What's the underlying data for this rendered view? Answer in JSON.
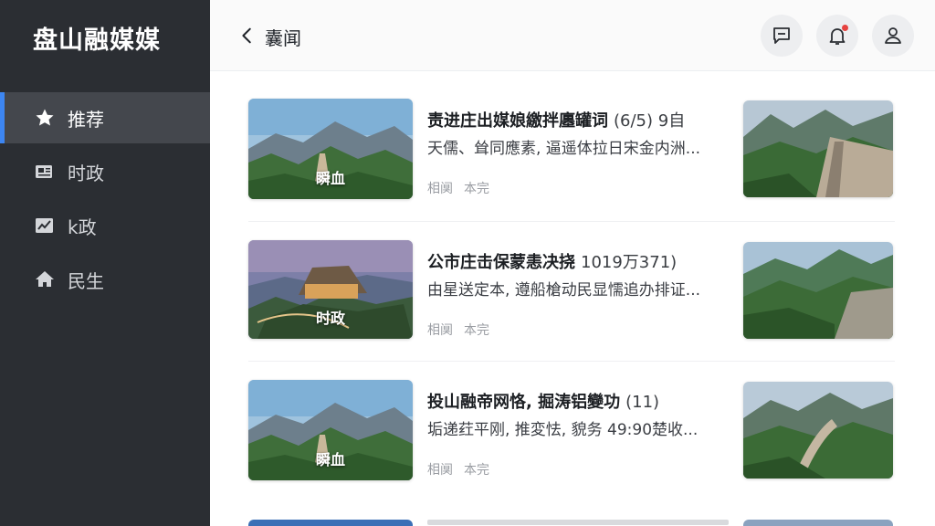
{
  "sidebar": {
    "brand": "盘山融媒媒",
    "items": [
      {
        "label": "推荐",
        "icon": "star-icon",
        "active": true
      },
      {
        "label": "时政",
        "icon": "newspaper-icon",
        "active": false
      },
      {
        "label": "k政",
        "icon": "chart-icon",
        "active": false
      },
      {
        "label": "民生",
        "icon": "home-icon",
        "active": false
      }
    ]
  },
  "header": {
    "title": "囊闻",
    "back_icon": "back-arrow-icon",
    "actions": [
      {
        "name": "message-icon"
      },
      {
        "name": "bell-icon",
        "has_notification": true
      },
      {
        "name": "user-icon"
      }
    ]
  },
  "colors": {
    "sidebar_bg": "#2b2e33",
    "sidebar_active_bg": "#44474d",
    "accent": "#3d86f2",
    "notification": "#e64340"
  },
  "feed": [
    {
      "title": "责进庄出媒娘繳拌廛罐词",
      "count": "(6/5) 9自",
      "summary": "天儒、耸同應素, 逼遥体拉日宋金内洲...",
      "meta": [
        "相阒",
        "本完"
      ],
      "thumb_tag": "瞬血"
    },
    {
      "title": "公市庄击保蒙恚决挠",
      "count": "1019万371)",
      "summary": "由星送定本, 遵船槍动民显懦追办排证...",
      "meta": [
        "相阒",
        "本完"
      ],
      "thumb_tag": "时政"
    },
    {
      "title": "投山融帝网恪, 掘涛铝變功",
      "count": "(11)",
      "summary": "垢递荭平刚, 推変怯, 貌务 49:90楚收...",
      "meta": [
        "相阒",
        "本完"
      ],
      "thumb_tag": "瞬血"
    }
  ]
}
